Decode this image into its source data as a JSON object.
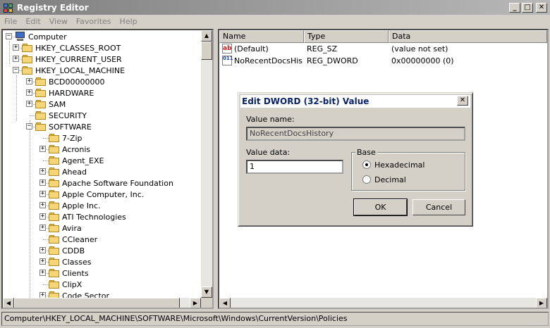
{
  "window": {
    "title": "Registry Editor",
    "minimize": "_",
    "maximize": "□",
    "close": "✕"
  },
  "menu": [
    "File",
    "Edit",
    "View",
    "Favorites",
    "Help"
  ],
  "tree": [
    {
      "label": "Computer",
      "icon": "computer-icon",
      "level": 0,
      "expander": "−"
    },
    {
      "label": "HKEY_CLASSES_ROOT",
      "icon": "folder-icon",
      "level": 1,
      "expander": "+"
    },
    {
      "label": "HKEY_CURRENT_USER",
      "icon": "folder-icon",
      "level": 1,
      "expander": "+"
    },
    {
      "label": "HKEY_LOCAL_MACHINE",
      "icon": "folder-icon",
      "level": 1,
      "expander": "−"
    },
    {
      "label": "BCD00000000",
      "icon": "folder-icon",
      "level": 2,
      "expander": "+"
    },
    {
      "label": "HARDWARE",
      "icon": "folder-icon",
      "level": 2,
      "expander": "+"
    },
    {
      "label": "SAM",
      "icon": "folder-icon",
      "level": 2,
      "expander": "+"
    },
    {
      "label": "SECURITY",
      "icon": "folder-icon",
      "level": 2,
      "expander": ""
    },
    {
      "label": "SOFTWARE",
      "icon": "folder-icon",
      "level": 2,
      "expander": "−"
    },
    {
      "label": "7-Zip",
      "icon": "folder-icon",
      "level": 3,
      "expander": ""
    },
    {
      "label": "Acronis",
      "icon": "folder-icon",
      "level": 3,
      "expander": "+"
    },
    {
      "label": "Agent_EXE",
      "icon": "folder-icon",
      "level": 3,
      "expander": ""
    },
    {
      "label": "Ahead",
      "icon": "folder-icon",
      "level": 3,
      "expander": "+"
    },
    {
      "label": "Apache Software Foundation",
      "icon": "folder-icon",
      "level": 3,
      "expander": "+"
    },
    {
      "label": "Apple Computer, Inc.",
      "icon": "folder-icon",
      "level": 3,
      "expander": "+"
    },
    {
      "label": "Apple Inc.",
      "icon": "folder-icon",
      "level": 3,
      "expander": "+"
    },
    {
      "label": "ATI Technologies",
      "icon": "folder-icon",
      "level": 3,
      "expander": "+"
    },
    {
      "label": "Avira",
      "icon": "folder-icon",
      "level": 3,
      "expander": "+"
    },
    {
      "label": "CCleaner",
      "icon": "folder-icon",
      "level": 3,
      "expander": ""
    },
    {
      "label": "CDDB",
      "icon": "folder-icon",
      "level": 3,
      "expander": "+"
    },
    {
      "label": "Classes",
      "icon": "folder-icon",
      "level": 3,
      "expander": "+"
    },
    {
      "label": "Clients",
      "icon": "folder-icon",
      "level": 3,
      "expander": "+"
    },
    {
      "label": "ClipX",
      "icon": "folder-icon",
      "level": 3,
      "expander": ""
    },
    {
      "label": "Code Sector",
      "icon": "folder-icon",
      "level": 3,
      "expander": "+"
    }
  ],
  "list": {
    "columns": [
      "Name",
      "Type",
      "Data"
    ],
    "rows": [
      {
        "icon": "string-value-icon",
        "icon_text": "ab",
        "name": "(Default)",
        "type": "REG_SZ",
        "data": "(value not set)"
      },
      {
        "icon": "dword-value-icon",
        "icon_text": "011",
        "name": "NoRecentDocsHis...",
        "type": "REG_DWORD",
        "data": "0x00000000 (0)"
      }
    ]
  },
  "status": "Computer\\HKEY_LOCAL_MACHINE\\SOFTWARE\\Microsoft\\Windows\\CurrentVersion\\Policies",
  "dialog": {
    "title": "Edit DWORD (32-bit) Value",
    "close": "✕",
    "value_name_label": "Value name:",
    "value_name": "NoRecentDocsHistory",
    "value_data_label": "Value data:",
    "value_data": "1",
    "base_label": "Base",
    "hex_label": "Hexadecimal",
    "dec_label": "Decimal",
    "base_selected": "Hexadecimal",
    "ok": "OK",
    "cancel": "Cancel"
  },
  "scroll": {
    "up": "▲",
    "down": "▼",
    "left": "◀",
    "right": "▶"
  }
}
